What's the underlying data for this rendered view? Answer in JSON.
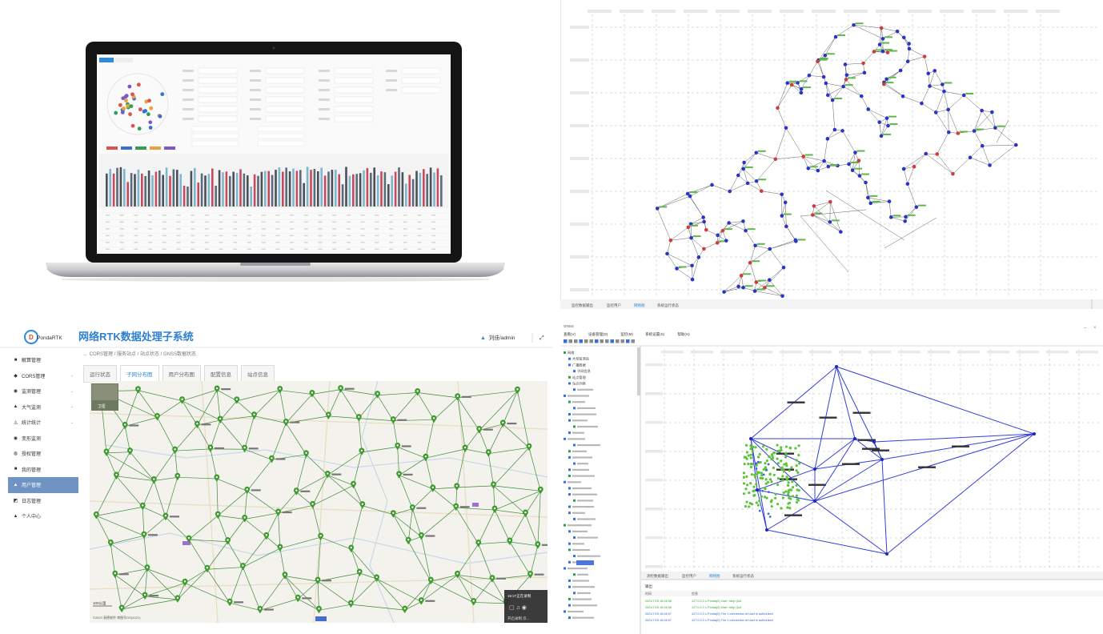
{
  "q2": {
    "bottom_tabs": [
      "监控数据输出",
      "监控用户",
      "网络图",
      "系统运行状态"
    ]
  },
  "q3": {
    "brand": "PondaRTK",
    "title": "网络RTK数据处理子系统",
    "user": "刘佳/admin",
    "breadcrumb": "← CORS管理 / 服务站点 / 站点状态 / GNSS数据状态",
    "tabs": [
      {
        "label": "运行状态",
        "active": false
      },
      {
        "label": "子网分布图",
        "active": true
      },
      {
        "label": "用户分布图",
        "active": false
      },
      {
        "label": "配置信息",
        "active": false
      },
      {
        "label": "站点信息",
        "active": false
      }
    ],
    "sidebar": [
      {
        "icon": "■",
        "label": "解算管理",
        "chevron": false,
        "active": false
      },
      {
        "icon": "◆",
        "label": "CORS管理",
        "chevron": true,
        "active": false
      },
      {
        "icon": "◉",
        "label": "监测管理",
        "chevron": true,
        "active": false
      },
      {
        "icon": "▲",
        "label": "大气监测",
        "chevron": true,
        "active": false
      },
      {
        "icon": "◬",
        "label": "统计统计",
        "chevron": true,
        "active": false
      },
      {
        "icon": "◉",
        "label": "变形监测",
        "chevron": false,
        "active": false
      },
      {
        "icon": "◍",
        "label": "授权管理",
        "chevron": false,
        "active": false
      },
      {
        "icon": "■",
        "label": "我的管理",
        "chevron": false,
        "active": false
      },
      {
        "icon": "▲",
        "label": "用户管理",
        "chevron": false,
        "active": true
      },
      {
        "icon": "◩",
        "label": "日志管理",
        "chevron": false,
        "active": false
      },
      {
        "icon": "▲",
        "label": "个人中心",
        "chevron": false,
        "active": false
      }
    ],
    "map_scale": "100公里",
    "map_copyright": "©2022 高德软件 审图号GS(2021)",
    "overlay_text": "15:27正在录制",
    "overlay_status": "开启录制,仅..."
  },
  "q4": {
    "window_title": "GNSS",
    "menu": [
      "查看(V)",
      "设备管理(D)",
      "监控(M)",
      "系统设置(S)",
      "帮助(H)"
    ],
    "tree_items": [
      "网络",
      "大型监测站",
      "广播数据",
      "子网信息",
      "站点管理",
      "站点列表"
    ],
    "bottom_tabs": [
      "测控数据输出",
      "监控用户",
      "网络图",
      "系统运行状态"
    ],
    "log_title": "输出",
    "log_headers": [
      "时间",
      "信息"
    ],
    "log_rows": [
      {
        "time": "2021/7/15 15:04:56",
        "msg": "127.0.0.1:1 Ponda(0) User: ntrip Quit",
        "color": "#2e9e2e"
      },
      {
        "time": "2021/7/15 15:04:56",
        "msg": "127.0.0.1:1 Ponda(0) User: ntrip Quit",
        "color": "#2e9e2e"
      },
      {
        "time": "2021/7/15 15:04:57",
        "msg": "127.0.0.1:1 Ponda(0) The 1 connection of User is authorized",
        "color": "#2e63c8"
      },
      {
        "time": "2021/7/15 15:04:57",
        "msg": "127.0.0.1:1 Ponda(0) The 1 connection of User is authorized",
        "color": "#2e63c8"
      }
    ]
  },
  "colors": {
    "accent": "#2f8bd6",
    "sidebar_active": "#6f94c4",
    "net_blue": "#3340d8",
    "station_green": "#3f9a2f",
    "map_line_green": "#3e8a3b"
  }
}
